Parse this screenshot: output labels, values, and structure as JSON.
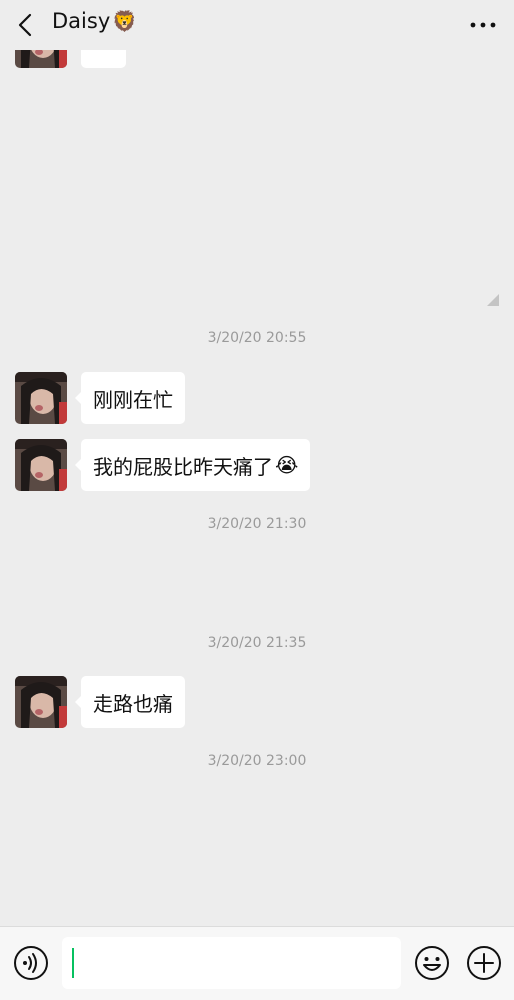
{
  "header": {
    "title": "Daisy",
    "title_emoji": "🦁",
    "back_icon": "chevron-left-icon",
    "more_icon": "ellipsis-icon"
  },
  "messages": [
    {
      "type": "timestamp",
      "text": "3/20/20 20:55"
    },
    {
      "type": "received",
      "text": "刚刚在忙"
    },
    {
      "type": "received",
      "text": "我的屁股比昨天痛了",
      "emoji": "😭"
    },
    {
      "type": "timestamp",
      "text": "3/20/20 21:30"
    },
    {
      "type": "timestamp",
      "text": "3/20/20 21:35"
    },
    {
      "type": "received",
      "text": "走路也痛"
    },
    {
      "type": "timestamp",
      "text": "3/20/20 23:00"
    }
  ],
  "input_bar": {
    "voice_icon": "voice-icon",
    "text_value": "",
    "emoji_icon": "emoji-icon",
    "plus_icon": "plus-icon"
  },
  "colors": {
    "background": "#ededed",
    "bubble": "#ffffff",
    "caret": "#07c160"
  }
}
